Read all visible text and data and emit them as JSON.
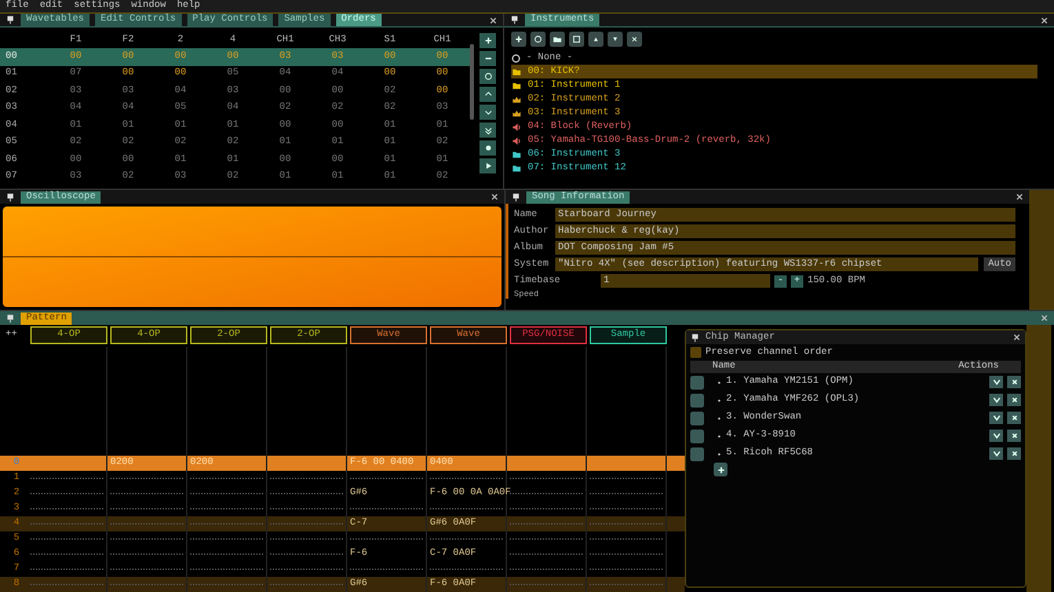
{
  "menu": [
    "file",
    "edit",
    "settings",
    "window",
    "help"
  ],
  "orders_panel": {
    "tabs": [
      {
        "label": "Wavetables",
        "selected": false
      },
      {
        "label": "Edit Controls",
        "selected": false
      },
      {
        "label": "Play Controls",
        "selected": false
      },
      {
        "label": "Samples",
        "selected": false
      },
      {
        "label": "Orders",
        "selected": true
      }
    ],
    "columns": [
      "F1",
      "F2",
      "2",
      "4",
      "CH1",
      "CH3",
      "S1",
      "CH1"
    ],
    "rows": [
      {
        "label": "00",
        "selected": true,
        "cells": [
          "00",
          "00",
          "00",
          "00",
          "03",
          "03",
          "00",
          "00"
        ],
        "highlighted": [
          true,
          true,
          true,
          true,
          true,
          true,
          true,
          true
        ]
      },
      {
        "label": "01",
        "selected": false,
        "cells": [
          "07",
          "00",
          "00",
          "05",
          "04",
          "04",
          "00",
          "00"
        ],
        "highlighted": [
          false,
          true,
          true,
          false,
          false,
          false,
          true,
          true
        ]
      },
      {
        "label": "02",
        "selected": false,
        "cells": [
          "03",
          "03",
          "04",
          "03",
          "00",
          "00",
          "02",
          "00"
        ],
        "highlighted": [
          false,
          false,
          false,
          false,
          false,
          false,
          false,
          true
        ]
      },
      {
        "label": "03",
        "selected": false,
        "cells": [
          "04",
          "04",
          "05",
          "04",
          "02",
          "02",
          "02",
          "03"
        ],
        "highlighted": [
          false,
          false,
          false,
          false,
          false,
          false,
          false,
          false
        ]
      },
      {
        "label": "04",
        "selected": false,
        "cells": [
          "01",
          "01",
          "01",
          "01",
          "00",
          "00",
          "01",
          "01"
        ],
        "highlighted": [
          false,
          false,
          false,
          false,
          false,
          false,
          false,
          false
        ]
      },
      {
        "label": "05",
        "selected": false,
        "cells": [
          "02",
          "02",
          "02",
          "02",
          "01",
          "01",
          "01",
          "02"
        ],
        "highlighted": [
          false,
          false,
          false,
          false,
          false,
          false,
          false,
          false
        ]
      },
      {
        "label": "06",
        "selected": false,
        "cells": [
          "00",
          "00",
          "01",
          "01",
          "00",
          "00",
          "01",
          "01"
        ],
        "highlighted": [
          false,
          false,
          false,
          false,
          false,
          false,
          false,
          false
        ]
      },
      {
        "label": "07",
        "selected": false,
        "cells": [
          "03",
          "02",
          "03",
          "02",
          "01",
          "01",
          "01",
          "02"
        ],
        "highlighted": [
          false,
          false,
          false,
          false,
          false,
          false,
          false,
          false
        ]
      }
    ]
  },
  "instruments_panel": {
    "title": "Instruments",
    "none_item": "- None -",
    "items": [
      {
        "label": "00: KICK?",
        "selected": true,
        "color": "#e8c000",
        "kind": "folder"
      },
      {
        "label": "01: Instrument 1",
        "selected": false,
        "color": "#e8c000",
        "kind": "folder"
      },
      {
        "label": "02: Instrument 2",
        "selected": false,
        "color": "#d8a020",
        "kind": "chart"
      },
      {
        "label": "03: Instrument 3",
        "selected": false,
        "color": "#d8a020",
        "kind": "chart"
      },
      {
        "label": "04: Block (Reverb)",
        "selected": false,
        "color": "#e06060",
        "kind": "speaker"
      },
      {
        "label": "05: Yamaha-TG100-Bass-Drum-2 (reverb, 32k)",
        "selected": false,
        "color": "#e06060",
        "kind": "speaker"
      },
      {
        "label": "06: Instrument 3",
        "selected": false,
        "color": "#40c8c8",
        "kind": "folder"
      },
      {
        "label": "07: Instrument 12",
        "selected": false,
        "color": "#40c8c8",
        "kind": "folder"
      }
    ]
  },
  "oscilloscope_panel": {
    "title": "Oscilloscope"
  },
  "song_info_panel": {
    "title": "Song Information",
    "fields": [
      {
        "label": "Name",
        "value": "Starboard Journey"
      },
      {
        "label": "Author",
        "value": "Haberchuck & reg(kay)"
      },
      {
        "label": "Album",
        "value": "DOT Composing Jam #5"
      },
      {
        "label": "System",
        "value": "\"Nitro 4X\" (see description) featuring WS1337-r6 chipset",
        "button": "Auto"
      }
    ],
    "timebase": {
      "label": "Timebase",
      "value": "1",
      "minus": "-",
      "plus": "+",
      "reading": "150.00 BPM"
    },
    "speed_label": "Speed"
  },
  "pattern_panel": {
    "title": "Pattern",
    "toggle": "++",
    "channels": [
      {
        "label": "4-OP",
        "color": "#b8b820"
      },
      {
        "label": "4-OP",
        "color": "#b8b820"
      },
      {
        "label": "2-OP",
        "color": "#b8b820"
      },
      {
        "label": "2-OP",
        "color": "#b8b820"
      },
      {
        "label": "Wave",
        "color": "#d87030"
      },
      {
        "label": "Wave",
        "color": "#d87030"
      },
      {
        "label": "PSG/NOISE",
        "color": "#e03040"
      },
      {
        "label": "Sample",
        "color": "#30c8a0"
      }
    ],
    "rows": [
      {
        "label": "0",
        "kind": "cursor",
        "cells": [
          "",
          "0200",
          "0200",
          "",
          "F-6 00 0400",
          "0400",
          "",
          ""
        ]
      },
      {
        "label": "1",
        "kind": "plain",
        "cells": [
          "",
          "",
          "",
          "",
          "",
          "",
          "",
          ""
        ]
      },
      {
        "label": "2",
        "kind": "plain",
        "cells": [
          "",
          "",
          "",
          "",
          "G#6",
          "F-6 00 0A 0A0F",
          "",
          ""
        ]
      },
      {
        "label": "3",
        "kind": "plain",
        "cells": [
          "",
          "",
          "",
          "",
          "",
          "",
          "",
          ""
        ]
      },
      {
        "label": "4",
        "kind": "beat",
        "cells": [
          "",
          "",
          "",
          "",
          "C-7",
          "G#6 0A0F",
          "",
          ""
        ]
      },
      {
        "label": "5",
        "kind": "plain",
        "cells": [
          "",
          "",
          "",
          "",
          "",
          "",
          "",
          ""
        ]
      },
      {
        "label": "6",
        "kind": "plain",
        "cells": [
          "",
          "",
          "",
          "",
          "F-6",
          "C-7 0A0F",
          "",
          ""
        ]
      },
      {
        "label": "7",
        "kind": "plain",
        "cells": [
          "",
          "",
          "",
          "",
          "",
          "",
          "",
          ""
        ]
      },
      {
        "label": "8",
        "kind": "beat",
        "cells": [
          "",
          "",
          "",
          "",
          "G#6",
          "F-6 0A0F",
          "",
          ""
        ]
      }
    ]
  },
  "chip_manager": {
    "title": "Chip Manager",
    "preserve": {
      "label": "Preserve channel order",
      "checked": false
    },
    "columns": [
      "Name",
      "Actions"
    ],
    "chips": [
      "1. Yamaha YM2151 (OPM)",
      "2. Yamaha YMF262 (OPL3)",
      "3. WonderSwan",
      "4. AY-3-8910",
      "5. Ricoh RF5C68"
    ]
  }
}
